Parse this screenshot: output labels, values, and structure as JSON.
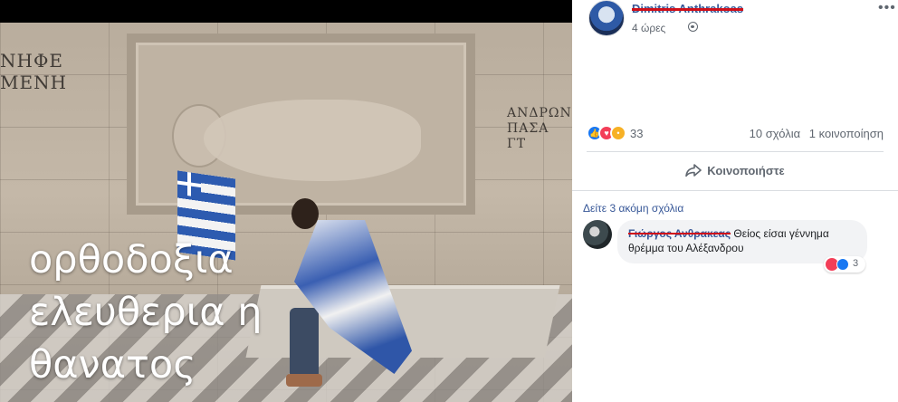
{
  "post": {
    "author": "Dimitris Anthrakoas",
    "time": "4 ώρες",
    "more": "•••",
    "photo": {
      "caption_lines": [
        "ορθοδοξια",
        "ελευθερια η",
        "θανατος"
      ],
      "engraving_left": [
        "ΝΗΦΕ",
        "ΜΕΝΗ"
      ],
      "engraving_right": [
        "ΑΝΔΡΩΝ",
        "ΠΑΣΑ ΓΤ"
      ]
    }
  },
  "stats": {
    "reaction_count": "33",
    "comments": "10 σχόλια",
    "shares": "1 κοινοποίηση"
  },
  "actions": {
    "share_label": "Κοινοποιήστε"
  },
  "comments": {
    "more_link": "Δείτε 3 ακόμη σχόλια",
    "items": [
      {
        "author": "Γιώργος Ανθρακεας",
        "text": "Θείος είσαι γέννημα θρέμμα του Αλέξανδρου",
        "reaction_count": "3"
      }
    ]
  },
  "colors": {
    "link": "#385898",
    "muted": "#606770",
    "like": "#1877f2",
    "love": "#f33e58",
    "wow": "#f7b125",
    "strike": "#d0101a"
  },
  "icons": [
    "globe-icon",
    "more-icon",
    "share-icon",
    "like-reaction-icon",
    "love-reaction-icon",
    "wow-reaction-icon"
  ]
}
